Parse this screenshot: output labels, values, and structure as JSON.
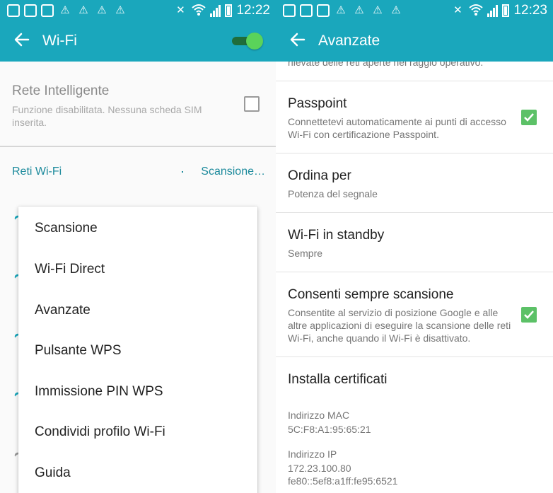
{
  "status_bar": {
    "left_time": "12:22",
    "right_time": "12:23",
    "notification_icons": [
      "chat-icon",
      "image-icon",
      "gallery-icon",
      "warning-icon",
      "warning-icon",
      "warning-icon",
      "warning-icon"
    ]
  },
  "left": {
    "app_title": "Wi-Fi",
    "wifi_toggle_on": true,
    "rete": {
      "title": "Rete Intelligente",
      "subtitle": "Funzione disabilitata. Nessuna scheda SIM inserita."
    },
    "reti_label": "Reti Wi-Fi",
    "scan_label": "Scansione…",
    "menu_items": [
      "Scansione",
      "Wi-Fi Direct",
      "Avanzate",
      "Pulsante WPS",
      "Immissione PIN WPS",
      "Condividi profilo Wi-Fi",
      "Guida"
    ]
  },
  "right": {
    "app_title": "Avanzate",
    "cut_text": "rilevate delle reti aperte nel raggio operativo.",
    "passpoint": {
      "title": "Passpoint",
      "subtitle": "Connettetevi automaticamente ai punti di accesso Wi-Fi con certificazione Passpoint.",
      "checked": true
    },
    "ordina": {
      "title": "Ordina per",
      "subtitle": "Potenza del segnale"
    },
    "standby": {
      "title": "Wi-Fi in standby",
      "subtitle": "Sempre"
    },
    "consenti": {
      "title": "Consenti sempre scansione",
      "subtitle": "Consentite al servizio di posizione Google e alle altre applicazioni di eseguire la scansione delle reti Wi-Fi, anche quando il Wi-Fi è disattivato.",
      "checked": true
    },
    "installa": {
      "title": "Installa certificati"
    },
    "mac": {
      "label": "Indirizzo MAC",
      "value": "5C:F8:A1:95:65:21"
    },
    "ip": {
      "label": "Indirizzo IP",
      "value1": "172.23.100.80",
      "value2": "fe80::5ef8:a1ff:fe95:6521"
    }
  },
  "colors": {
    "accent": "#1aa7bc",
    "link": "#1c8a9c",
    "checkbox": "#5cc167",
    "toggle_thumb": "#5ad35a"
  }
}
